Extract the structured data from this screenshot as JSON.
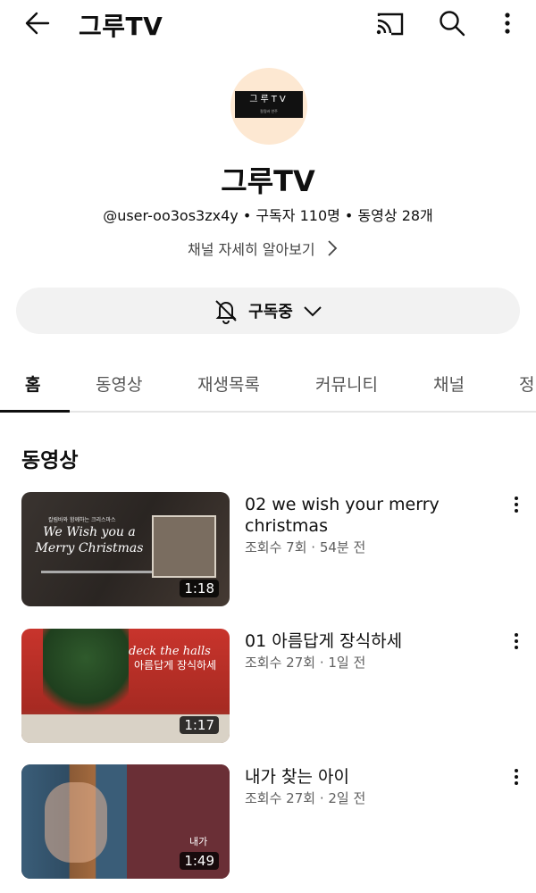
{
  "appbar": {
    "title": "그루TV"
  },
  "channel": {
    "avatar_text": "그루TV",
    "avatar_subtext": "칼림바 연주",
    "name": "그루TV",
    "meta": "@user-oo3os3zx4y • 구독자 110명 • 동영상 28개",
    "about": "채널 자세히 알아보기"
  },
  "subscribe": {
    "label": "구독중"
  },
  "tabs": [
    "홈",
    "동영상",
    "재생목록",
    "커뮤니티",
    "채널",
    "정"
  ],
  "section": {
    "title": "동영상"
  },
  "videos": [
    {
      "title": "02 we wish your merry christmas",
      "meta": "조회수 7회 · 54분 전",
      "duration": "1:18",
      "thumb_caption": "칼림바와 함께하는 크리스마스",
      "thumb_script": "We Wish you a Merry Christmas"
    },
    {
      "title": "01 아름답게 장식하세",
      "meta": "조회수 27회 · 1일 전",
      "duration": "1:17",
      "thumb_heading": "deck the halls",
      "thumb_korean": "아름답게 장식하세"
    },
    {
      "title": "내가 찾는 아이",
      "meta": "조회수 27회 · 2일 전",
      "duration": "1:49",
      "thumb_text": "내가"
    }
  ]
}
